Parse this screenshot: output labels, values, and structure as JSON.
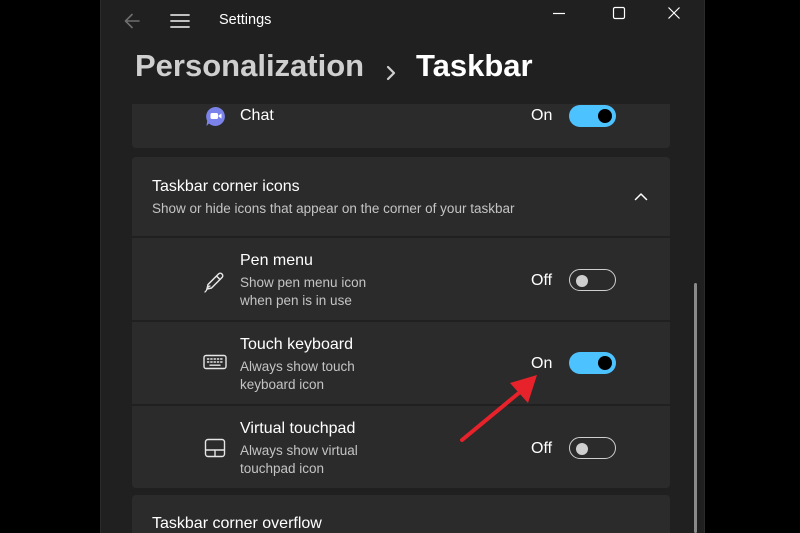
{
  "window": {
    "title": "Settings",
    "breadcrumb": {
      "parent": "Personalization",
      "separator": "›",
      "current": "Taskbar"
    }
  },
  "chat_row": {
    "label": "Chat",
    "state": "On",
    "toggle_on": true
  },
  "corner_icons_section": {
    "title": "Taskbar corner icons",
    "subtitle": "Show or hide icons that appear on the corner of your taskbar",
    "expanded": true,
    "items": [
      {
        "title": "Pen menu",
        "desc1": "Show pen menu icon",
        "desc2": "when pen is in use",
        "state": "Off",
        "toggle_on": false,
        "icon": "pen-icon"
      },
      {
        "title": "Touch keyboard",
        "desc1": "Always show touch",
        "desc2": "keyboard icon",
        "state": "On",
        "toggle_on": true,
        "icon": "keyboard-icon"
      },
      {
        "title": "Virtual touchpad",
        "desc1": "Always show virtual",
        "desc2": "touchpad icon",
        "state": "Off",
        "toggle_on": false,
        "icon": "touchpad-icon"
      }
    ]
  },
  "overflow_section": {
    "title": "Taskbar corner overflow"
  },
  "colors": {
    "window_bg": "#202020",
    "card_bg": "#2b2b2b",
    "accent": "#4cc2ff",
    "annotation_arrow": "#e8222a",
    "chat_icon": "#7b83eb"
  }
}
